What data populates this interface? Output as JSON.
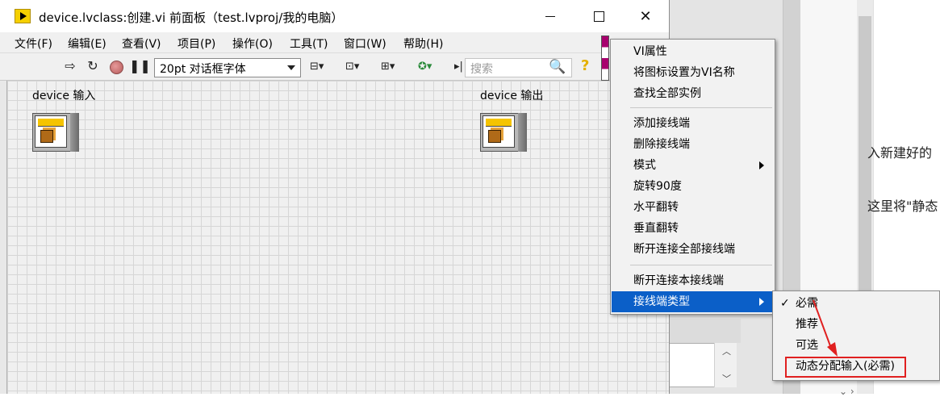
{
  "window": {
    "title": "device.lvclass:创建.vi 前面板（test.lvproj/我的电脑）",
    "controls": {
      "minimize": "minimize",
      "maximize": "maximize",
      "close": "✕"
    }
  },
  "menubar": [
    "文件(F)",
    "编辑(E)",
    "查看(V)",
    "项目(P)",
    "操作(O)",
    "工具(T)",
    "窗口(W)",
    "帮助(H)"
  ],
  "toolbar": {
    "font": "20pt 对话框字体",
    "search_placeholder": "搜索",
    "help": "?"
  },
  "front_panel": {
    "input_label": "device 输入",
    "output_label": "device 输出"
  },
  "context_menu": {
    "items": [
      "VI属性",
      "将图标设置为VI名称",
      "查找全部实例",
      "添加接线端",
      "删除接线端",
      "模式",
      "旋转90度",
      "水平翻转",
      "垂直翻转",
      "断开连接全部接线端",
      "断开连接本接线端",
      "接线端类型"
    ],
    "highlighted": "接线端类型"
  },
  "submenu": {
    "items": [
      "必需",
      "推荐",
      "可选",
      "动态分配输入(必需)"
    ],
    "checked": "必需",
    "highlighted_annotation": "动态分配输入(必需)",
    "annotation_color": "#e02020"
  },
  "background_doc": {
    "line1": "入新建好的",
    "line2": "这里将\"静态"
  },
  "colors": {
    "highlight": "#0b5fc8",
    "annotation": "#e02020"
  }
}
